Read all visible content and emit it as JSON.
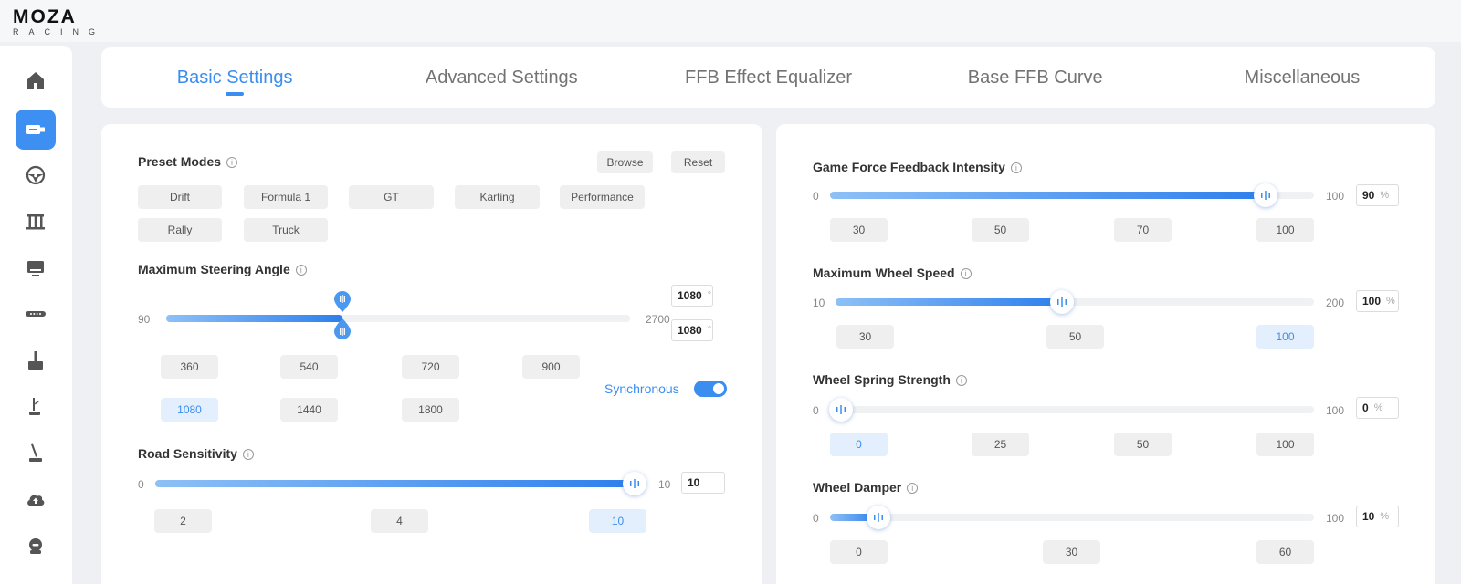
{
  "brand": {
    "line1": "MOZA",
    "line2": "RACING"
  },
  "sidebar": {
    "items": [
      {
        "icon": "home-icon",
        "active": false
      },
      {
        "icon": "wheelbase-icon",
        "active": true
      },
      {
        "icon": "steering-wheel-icon",
        "active": false
      },
      {
        "icon": "pedals-icon",
        "active": false
      },
      {
        "icon": "dashboard-display-icon",
        "active": false
      },
      {
        "icon": "led-bar-icon",
        "active": false
      },
      {
        "icon": "shifter-icon",
        "active": false
      },
      {
        "icon": "handbrake-icon",
        "active": false
      },
      {
        "icon": "sequential-shifter-icon",
        "active": false
      },
      {
        "icon": "cloud-upload-icon",
        "active": false
      },
      {
        "icon": "user-profile-icon",
        "active": false
      }
    ]
  },
  "tabs": [
    {
      "label": "Basic Settings",
      "active": true
    },
    {
      "label": "Advanced Settings",
      "active": false
    },
    {
      "label": "FFB Effect Equalizer",
      "active": false
    },
    {
      "label": "Base FFB Curve",
      "active": false
    },
    {
      "label": "Miscellaneous",
      "active": false
    }
  ],
  "preset": {
    "label": "Preset Modes",
    "browse": "Browse",
    "reset": "Reset",
    "modes": [
      "Drift",
      "Formula 1",
      "GT",
      "Karting",
      "Performance",
      "Rally",
      "Truck"
    ]
  },
  "steering": {
    "label": "Maximum Steering Angle",
    "min": "90",
    "max": "2700",
    "value": 1080,
    "value_top": "1080",
    "value_bottom": "1080",
    "unit": "°",
    "presets": [
      "360",
      "540",
      "720",
      "900",
      "1080",
      "1440",
      "1800"
    ],
    "selected": "1080",
    "sync_label": "Synchronous",
    "sync_on": true
  },
  "road": {
    "label": "Road Sensitivity",
    "min": "0",
    "max": "10",
    "value": "10",
    "presets": [
      "2",
      "4",
      "10"
    ],
    "selected": "10"
  },
  "ffb": {
    "label": "Game Force Feedback Intensity",
    "min": "0",
    "max": "100",
    "value": "90",
    "unit": "%",
    "presets": [
      "30",
      "50",
      "70",
      "100"
    ],
    "selected": ""
  },
  "wheel_speed": {
    "label": "Maximum Wheel Speed",
    "min": "10",
    "max": "200",
    "value": "100",
    "unit": "%",
    "presets": [
      "30",
      "50",
      "100"
    ],
    "selected": "100"
  },
  "spring": {
    "label": "Wheel Spring Strength",
    "min": "0",
    "max": "100",
    "value": "0",
    "unit": "%",
    "presets": [
      "0",
      "25",
      "50",
      "100"
    ],
    "selected": "0"
  },
  "damper": {
    "label": "Wheel Damper",
    "min": "0",
    "max": "100",
    "value": "10",
    "unit": "%",
    "presets": [
      "0",
      "30",
      "60"
    ],
    "selected": ""
  }
}
